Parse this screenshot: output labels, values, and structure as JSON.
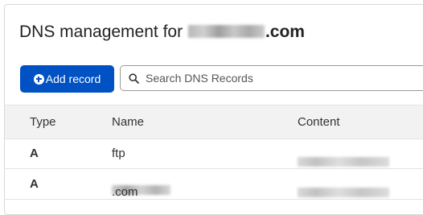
{
  "header": {
    "title_prefix": "DNS management for",
    "title_domain_tld": ".com"
  },
  "toolbar": {
    "add_record_label": "Add record",
    "search_placeholder": "Search DNS Records"
  },
  "table": {
    "columns": [
      "Type",
      "Name",
      "Content"
    ],
    "rows": [
      {
        "type": "A",
        "name": "ftp",
        "name_suffix": "",
        "content": ""
      },
      {
        "type": "A",
        "name": "",
        "name_suffix": ".com",
        "content": ""
      }
    ]
  },
  "icons": {
    "add": "plus-circle-icon",
    "search": "search-icon"
  },
  "colors": {
    "accent": "#0051c3",
    "header_bg": "#f2f2f2"
  }
}
